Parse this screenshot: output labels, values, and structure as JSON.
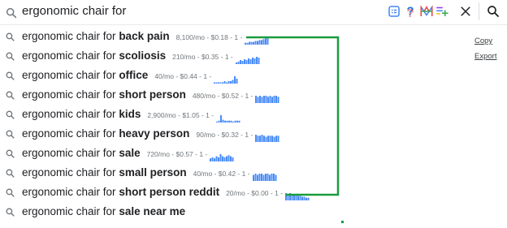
{
  "search": {
    "query": "ergonomic chair for"
  },
  "toolbar": {
    "icons": [
      "clipboard-list-icon",
      "question-icon",
      "m-logo-icon",
      "playlist-add-icon"
    ],
    "clear_icon": "close-icon",
    "search_icon": "search-icon"
  },
  "suggestions": [
    {
      "prefix": "ergonomic chair for ",
      "bold": "back pain",
      "meta": "8,100/mo - $0.18 - 1 -",
      "bars": [
        2,
        2,
        3,
        3,
        3,
        4,
        4,
        5,
        5,
        6,
        7,
        8
      ]
    },
    {
      "prefix": "ergonomic chair for ",
      "bold": "scoliosis",
      "meta": "210/mo - $0.35 - 1 -",
      "bars": [
        2,
        3,
        5,
        4,
        6,
        5,
        7,
        6,
        8,
        7,
        9,
        8
      ]
    },
    {
      "prefix": "ergonomic chair for ",
      "bold": "office",
      "meta": "40/mo - $0.44 - 1 -",
      "bars": [
        1,
        1,
        1,
        1,
        1,
        2,
        1,
        2,
        2,
        3,
        6,
        4
      ]
    },
    {
      "prefix": "ergonomic chair for ",
      "bold": "short person",
      "meta": "480/mo - $0.52 - 1 -",
      "bars": [
        7,
        6,
        7,
        6,
        7,
        7,
        6,
        7,
        6,
        7,
        7,
        6
      ]
    },
    {
      "prefix": "ergonomic chair for ",
      "bold": "kids",
      "meta": "2,900/mo - $1.05 - 1 -",
      "bars": [
        1,
        2,
        8,
        3,
        2,
        2,
        2,
        2,
        1,
        2,
        2,
        2
      ]
    },
    {
      "prefix": "ergonomic chair for ",
      "bold": "heavy person",
      "meta": "90/mo - $0.32 - 1 -",
      "bars": [
        7,
        6,
        6,
        7,
        6,
        5,
        6,
        6,
        6,
        5,
        6,
        6
      ]
    },
    {
      "prefix": "ergonomic chair for ",
      "bold": "sale",
      "meta": "720/mo - $0.57 - 1 -",
      "bars": [
        3,
        4,
        3,
        5,
        4,
        7,
        5,
        4,
        5,
        6,
        5,
        4
      ]
    },
    {
      "prefix": "ergonomic chair for ",
      "bold": "small person",
      "meta": "40/mo - $0.42 - 1 -",
      "bars": [
        5,
        6,
        5,
        6,
        6,
        5,
        6,
        6,
        5,
        6,
        6,
        5
      ]
    },
    {
      "prefix": "ergonomic chair for ",
      "bold": "short person reddit",
      "meta": "20/mo - $0.00 - 1 -",
      "bars": [
        8,
        7,
        8,
        6,
        7,
        6,
        5,
        5,
        4,
        4,
        3,
        3
      ]
    },
    {
      "prefix": "ergonomic chair for ",
      "bold": "sale near me",
      "meta": "",
      "bars": []
    }
  ],
  "side": {
    "copy_label": "Copy",
    "export_label": "Export"
  },
  "colors": {
    "bar": "#4a8cf7",
    "bracket": "#1a9c3e",
    "icon_gray": "#70757a",
    "accent_blue": "#4285f4"
  }
}
